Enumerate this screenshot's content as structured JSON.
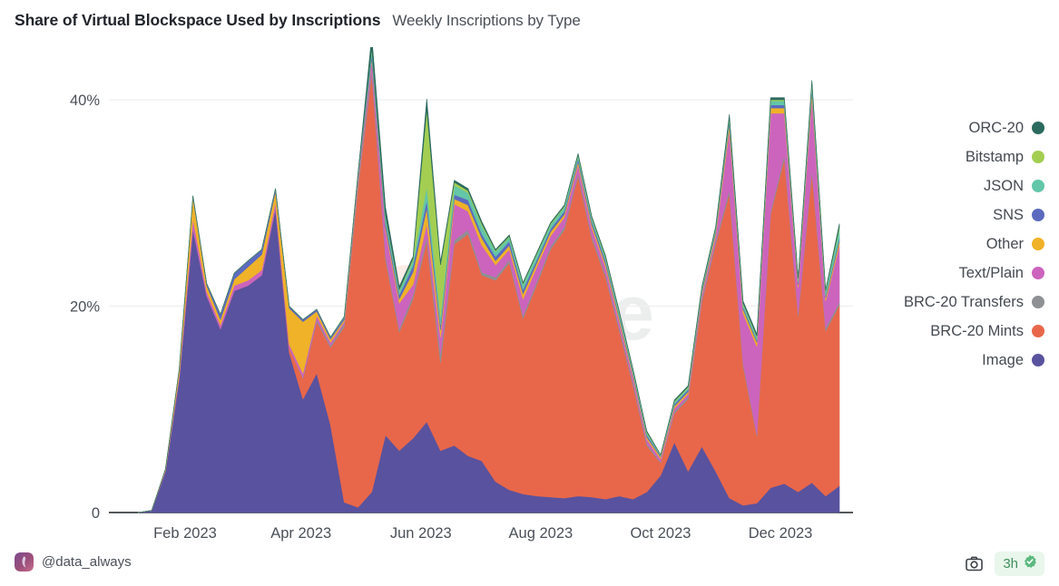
{
  "header": {
    "title": "Share of Virtual Blockspace Used by Inscriptions",
    "subtitle": "Weekly Inscriptions by Type"
  },
  "footer": {
    "author_handle": "@data_always",
    "camera_icon": "camera-icon",
    "freshness_label": "3h",
    "verified_icon": "verified-badge-icon",
    "badge_bg": "#e9f6ec",
    "badge_text_color": "#3f8f5c"
  },
  "watermark": {
    "text": "Dune"
  },
  "legend": {
    "position": "right",
    "items": [
      {
        "label": "ORC-20",
        "color": "#2b6a5f"
      },
      {
        "label": "Bitstamp",
        "color": "#a3ce52"
      },
      {
        "label": "JSON",
        "color": "#63c6a8"
      },
      {
        "label": "SNS",
        "color": "#5b6abf"
      },
      {
        "label": "Other",
        "color": "#efb228"
      },
      {
        "label": "Text/Plain",
        "color": "#cc64bd"
      },
      {
        "label": "BRC-20 Transfers",
        "color": "#8f9094"
      },
      {
        "label": "BRC-20 Mints",
        "color": "#e8674a"
      },
      {
        "label": "Image",
        "color": "#59529e"
      }
    ]
  },
  "chart_data": {
    "type": "area",
    "stacked": true,
    "title": "Share of Virtual Blockspace Used by Inscriptions",
    "subtitle": "Weekly Inscriptions by Type",
    "xlabel": "",
    "ylabel": "",
    "ylim": [
      0,
      44
    ],
    "yticks": [
      0,
      20,
      40
    ],
    "ytick_labels": [
      "0",
      "20%",
      "40%"
    ],
    "grid": "horizontal",
    "xtick_labels": [
      "Feb 2023",
      "Apr 2023",
      "Jun 2023",
      "Aug 2023",
      "Oct 2023",
      "Dec 2023"
    ],
    "xtick_dates": [
      "2023-02-01",
      "2023-04-01",
      "2023-06-01",
      "2023-08-01",
      "2023-10-01",
      "2023-12-01"
    ],
    "x": [
      "2023-01-08",
      "2023-01-15",
      "2023-01-22",
      "2023-01-29",
      "2023-02-05",
      "2023-02-12",
      "2023-02-19",
      "2023-02-26",
      "2023-03-05",
      "2023-03-12",
      "2023-03-19",
      "2023-03-26",
      "2023-04-02",
      "2023-04-09",
      "2023-04-16",
      "2023-04-23",
      "2023-04-30",
      "2023-05-07",
      "2023-05-14",
      "2023-05-21",
      "2023-05-28",
      "2023-06-04",
      "2023-06-11",
      "2023-06-18",
      "2023-06-25",
      "2023-07-02",
      "2023-07-09",
      "2023-07-16",
      "2023-07-23",
      "2023-07-30",
      "2023-08-06",
      "2023-08-13",
      "2023-08-20",
      "2023-08-27",
      "2023-09-03",
      "2023-09-10",
      "2023-09-17",
      "2023-09-24",
      "2023-10-01",
      "2023-10-08",
      "2023-10-15",
      "2023-10-22",
      "2023-10-29",
      "2023-11-05",
      "2023-11-12",
      "2023-11-19",
      "2023-11-26",
      "2023-12-03",
      "2023-12-10",
      "2023-12-17",
      "2023-12-24",
      "2023-12-31"
    ],
    "stack_order_bottom_to_top": [
      "Image",
      "BRC-20 Mints",
      "BRC-20 Transfers",
      "Text/Plain",
      "Other",
      "SNS",
      "JSON",
      "Bitstamp",
      "ORC-20"
    ],
    "series": [
      {
        "name": "Image",
        "color": "#59529e",
        "values": [
          0.0,
          0.2,
          4.0,
          13.0,
          27.5,
          21.0,
          17.8,
          21.5,
          22.0,
          23.0,
          29.5,
          15.5,
          11.0,
          13.5,
          8.5,
          1.0,
          0.5,
          2.0,
          7.5,
          6.0,
          7.2,
          8.8,
          6.0,
          6.5,
          5.5,
          5.0,
          3.0,
          2.2,
          1.8,
          1.6,
          1.5,
          1.4,
          1.6,
          1.5,
          1.3,
          1.6,
          1.3,
          2.0,
          3.6,
          6.8,
          4.0,
          6.4,
          4.0,
          1.4,
          0.7,
          0.9,
          2.4,
          2.8,
          2.0,
          2.9,
          1.6,
          2.6
        ]
      },
      {
        "name": "BRC-20 Mints",
        "color": "#e8674a",
        "values": [
          0.0,
          0.0,
          0.0,
          0.0,
          0.0,
          0.0,
          0.0,
          0.0,
          0.0,
          0.0,
          0.0,
          0.4,
          2.0,
          5.0,
          7.5,
          17.0,
          31.0,
          40.5,
          17.0,
          11.5,
          13.5,
          17.5,
          8.5,
          19.5,
          21.5,
          18.0,
          19.5,
          22.0,
          17.0,
          20.5,
          24.0,
          26.0,
          31.0,
          25.0,
          21.5,
          16.0,
          11.0,
          4.5,
          1.2,
          2.8,
          7.0,
          14.0,
          22.0,
          29.5,
          13.5,
          6.5,
          26.5,
          31.5,
          17.0,
          30.0,
          16.0,
          17.5
        ]
      },
      {
        "name": "BRC-20 Transfers",
        "color": "#8f9094",
        "values": [
          0.0,
          0.0,
          0.0,
          0.0,
          0.0,
          0.0,
          0.0,
          0.0,
          0.0,
          0.0,
          0.0,
          0.0,
          0.1,
          0.2,
          0.2,
          0.3,
          0.4,
          0.5,
          0.4,
          0.3,
          0.4,
          0.5,
          0.9,
          0.4,
          0.4,
          0.3,
          0.3,
          0.3,
          0.3,
          0.3,
          0.3,
          0.3,
          0.3,
          0.3,
          0.3,
          0.3,
          0.3,
          0.2,
          0.1,
          0.2,
          0.2,
          0.3,
          0.3,
          0.4,
          0.3,
          0.2,
          0.3,
          0.4,
          0.3,
          0.4,
          0.3,
          0.3
        ]
      },
      {
        "name": "Text/Plain",
        "color": "#cc64bd",
        "values": [
          0.0,
          0.0,
          0.1,
          0.3,
          1.0,
          0.4,
          0.4,
          0.5,
          0.5,
          0.5,
          0.6,
          0.4,
          0.4,
          0.4,
          0.3,
          0.2,
          0.3,
          0.8,
          2.5,
          2.5,
          1.0,
          1.2,
          1.6,
          3.5,
          1.8,
          2.6,
          1.2,
          1.0,
          1.6,
          1.4,
          1.0,
          0.9,
          0.8,
          0.8,
          0.7,
          0.6,
          0.5,
          0.4,
          0.3,
          0.3,
          0.3,
          0.4,
          0.5,
          5.8,
          4.8,
          8.5,
          9.5,
          4.0,
          2.5,
          7.0,
          2.6,
          5.5
        ]
      },
      {
        "name": "Other",
        "color": "#efb228",
        "values": [
          0.0,
          0.0,
          0.1,
          0.5,
          2.0,
          0.6,
          0.5,
          0.6,
          1.3,
          1.5,
          1.0,
          3.5,
          5.0,
          0.4,
          0.3,
          0.2,
          0.2,
          0.2,
          0.3,
          0.4,
          1.2,
          1.5,
          0.7,
          0.5,
          0.6,
          0.7,
          0.4,
          0.4,
          0.5,
          0.4,
          0.4,
          0.3,
          0.3,
          0.3,
          0.3,
          0.3,
          0.2,
          0.2,
          0.2,
          0.2,
          0.2,
          0.2,
          0.3,
          0.5,
          0.4,
          0.4,
          0.5,
          0.5,
          0.3,
          0.5,
          0.3,
          0.4
        ]
      },
      {
        "name": "SNS",
        "color": "#5b6abf",
        "values": [
          0.0,
          0.0,
          0.0,
          0.1,
          0.2,
          0.2,
          0.5,
          0.6,
          0.6,
          0.5,
          0.3,
          0.2,
          0.2,
          0.2,
          0.2,
          0.2,
          0.3,
          0.5,
          0.5,
          0.4,
          0.6,
          0.8,
          0.5,
          0.4,
          0.5,
          0.4,
          0.4,
          0.4,
          0.4,
          0.3,
          0.3,
          0.3,
          0.3,
          0.3,
          0.3,
          0.2,
          0.2,
          0.2,
          0.1,
          0.2,
          0.2,
          0.2,
          0.2,
          0.3,
          0.2,
          0.2,
          0.3,
          0.3,
          0.2,
          0.3,
          0.2,
          0.3
        ]
      },
      {
        "name": "JSON",
        "color": "#63c6a8",
        "values": [
          0.0,
          0.0,
          0.0,
          0.0,
          0.0,
          0.0,
          0.0,
          0.0,
          0.0,
          0.0,
          0.0,
          0.0,
          0.0,
          0.0,
          0.0,
          0.1,
          0.2,
          0.4,
          0.5,
          0.4,
          0.5,
          1.3,
          0.8,
          0.9,
          0.7,
          0.8,
          0.5,
          0.4,
          0.5,
          0.5,
          0.4,
          0.4,
          0.3,
          0.3,
          0.3,
          0.3,
          0.2,
          0.2,
          0.1,
          0.2,
          0.2,
          0.2,
          0.2,
          0.3,
          0.3,
          0.3,
          0.4,
          0.4,
          0.3,
          0.5,
          0.4,
          0.9
        ]
      },
      {
        "name": "Bitstamp",
        "color": "#a3ce52",
        "values": [
          0.0,
          0.0,
          0.0,
          0.0,
          0.0,
          0.0,
          0.0,
          0.0,
          0.0,
          0.0,
          0.0,
          0.0,
          0.0,
          0.0,
          0.0,
          0.0,
          0.0,
          0.1,
          0.1,
          0.1,
          0.2,
          7.5,
          5.0,
          0.3,
          0.2,
          0.2,
          0.1,
          0.1,
          0.1,
          0.1,
          0.1,
          0.1,
          0.1,
          0.1,
          0.1,
          0.1,
          0.1,
          0.1,
          0.0,
          0.1,
          0.1,
          0.1,
          0.1,
          0.1,
          0.1,
          0.1,
          0.1,
          0.1,
          0.1,
          0.1,
          0.1,
          0.2
        ]
      },
      {
        "name": "ORC-20",
        "color": "#2b6a5f",
        "values": [
          0.0,
          0.0,
          0.0,
          0.0,
          0.0,
          0.0,
          0.0,
          0.0,
          0.0,
          0.0,
          0.0,
          0.0,
          0.0,
          0.0,
          0.0,
          0.0,
          0.0,
          1.2,
          0.8,
          0.3,
          0.2,
          1.0,
          0.3,
          0.2,
          0.2,
          0.2,
          0.1,
          0.1,
          0.1,
          0.1,
          0.1,
          0.1,
          0.1,
          0.1,
          0.1,
          0.1,
          0.1,
          0.1,
          0.0,
          0.1,
          0.1,
          0.1,
          0.1,
          0.3,
          0.2,
          0.2,
          0.2,
          0.2,
          0.1,
          0.2,
          0.1,
          0.3
        ]
      }
    ]
  }
}
